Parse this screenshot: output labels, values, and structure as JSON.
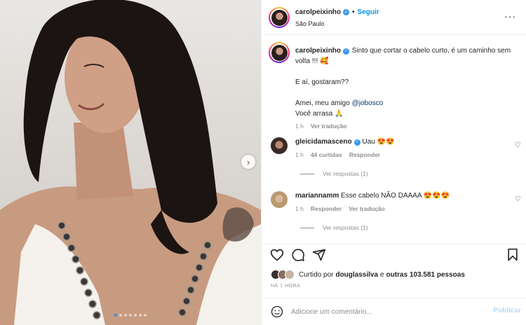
{
  "post": {
    "carousel": {
      "dot_count": 7,
      "active_index": 0
    }
  },
  "header": {
    "username": "carolpeixinho",
    "separator": "•",
    "follow_label": "Seguir",
    "location": "São Paulo",
    "more_icon": "more-horizontal-icon"
  },
  "caption": {
    "username": "carolpeixinho",
    "line1": " Sinto que cortar o cabelo curto, é um caminho sem volta !!! 🥰",
    "line2": "E aí, gostaram??",
    "line3_prefix": "Amei, meu amigo ",
    "mention": "@jobosco",
    "line4": "Você arrasa 🙏",
    "time": "1 h",
    "translate": "Ver tradução"
  },
  "comments": [
    {
      "username": "gleicidamasceno",
      "text": " Uau 😍😍",
      "time": "1 h",
      "likes": "44 curtidas",
      "reply": "Responder",
      "replies_label": "Ver respostas (1)"
    },
    {
      "username": "mariannamm",
      "text": " Esse cabelo NÃO DAAAA 😍😍😍",
      "time": "1 h",
      "reply": "Responder",
      "translate": "Ver tradução",
      "replies_label": "Ver respostas (1)"
    }
  ],
  "likes": {
    "prefix": "Curtido por ",
    "first_user": "douglassilva",
    "middle": " e ",
    "others": "outras 103.581 pessoas"
  },
  "timestamp": "HÁ 1 HORA",
  "comment_box": {
    "placeholder": "Adicione um comentário...",
    "publish_label": "Publicar"
  },
  "colors": {
    "accent": "#0095f6",
    "verified": "#3897f0",
    "muted": "#8e8e8e"
  }
}
